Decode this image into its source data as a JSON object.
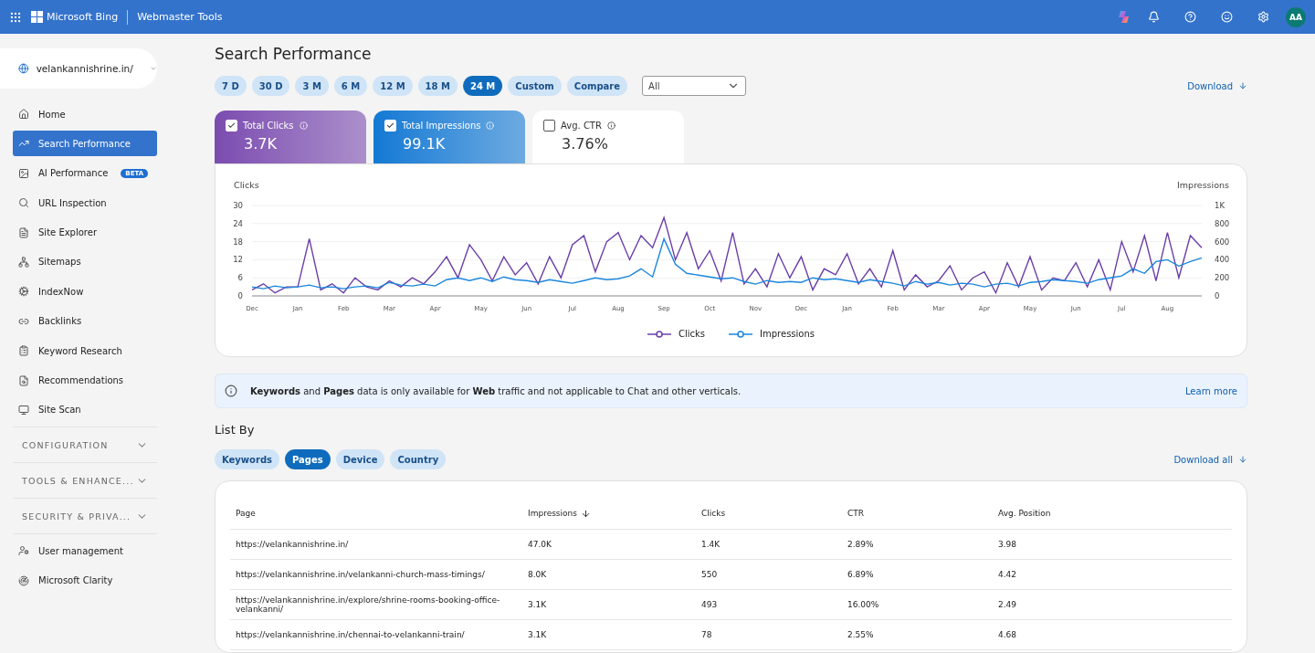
{
  "header": {
    "brand": "Microsoft Bing",
    "product": "Webmaster Tools",
    "avatar": "AA"
  },
  "sidebar": {
    "site": "velankannishrine.in/",
    "items": [
      {
        "label": "Home",
        "selected": false
      },
      {
        "label": "Search Performance",
        "selected": true
      },
      {
        "label": "AI Performance",
        "selected": false,
        "badge": "BETA"
      },
      {
        "label": "URL Inspection",
        "selected": false
      },
      {
        "label": "Site Explorer",
        "selected": false
      },
      {
        "label": "Sitemaps",
        "selected": false
      },
      {
        "label": "IndexNow",
        "selected": false
      },
      {
        "label": "Backlinks",
        "selected": false
      },
      {
        "label": "Keyword Research",
        "selected": false
      },
      {
        "label": "Recommendations",
        "selected": false
      },
      {
        "label": "Site Scan",
        "selected": false
      }
    ],
    "sections": [
      {
        "label": "CONFIGURATION",
        "expanded": false
      },
      {
        "label": "TOOLS & ENHANCE...",
        "expanded": false
      },
      {
        "label": "SECURITY & PRIVA...",
        "expanded": false
      }
    ],
    "footer_items": [
      {
        "label": "User management"
      },
      {
        "label": "Microsoft Clarity"
      }
    ]
  },
  "page": {
    "title": "Search Performance",
    "ranges": [
      {
        "label": "7 D",
        "selected": false
      },
      {
        "label": "30 D",
        "selected": false
      },
      {
        "label": "3 M",
        "selected": false
      },
      {
        "label": "6 M",
        "selected": false
      },
      {
        "label": "12 M",
        "selected": false
      },
      {
        "label": "18 M",
        "selected": false
      },
      {
        "label": "24 M",
        "selected": true
      },
      {
        "label": "Custom",
        "selected": false
      },
      {
        "label": "Compare",
        "selected": false
      }
    ],
    "filter": {
      "value": "All"
    },
    "download": "Download",
    "metrics": [
      {
        "label": "Total Clicks",
        "value": "3.7K",
        "checked": true,
        "color": "#7b4cb0"
      },
      {
        "label": "Total Impressions",
        "value": "99.1K",
        "checked": true,
        "color": "#1479d4"
      },
      {
        "label": "Avg. CTR",
        "value": "3.76%",
        "checked": false
      }
    ],
    "chart_data": {
      "type": "line",
      "grid": true,
      "legend": "bottom",
      "ylabel": "Clicks",
      "y2label": "Impressions",
      "categories": [
        "Dec",
        null,
        null,
        null,
        "Jan",
        null,
        null,
        null,
        "Feb",
        null,
        null,
        null,
        "Mar",
        null,
        null,
        null,
        "Apr",
        null,
        null,
        null,
        "May",
        null,
        null,
        null,
        "Jun",
        null,
        null,
        null,
        "Jul",
        null,
        null,
        null,
        "Aug",
        null,
        null,
        null,
        "Sep",
        null,
        null,
        null,
        "Oct",
        null,
        null,
        null,
        "Nov",
        null,
        null,
        null,
        "Dec",
        null,
        null,
        null,
        "Jan",
        null,
        null,
        null,
        "Feb",
        null,
        null,
        null,
        "Mar",
        null,
        null,
        null,
        "Apr",
        null,
        null,
        null,
        "May",
        null,
        null,
        null,
        "Jun",
        null,
        null,
        null,
        "Jul",
        null,
        null,
        null,
        "Aug",
        null,
        null,
        null
      ],
      "ylim": [
        0,
        30
      ],
      "yticks": [
        0,
        6,
        12,
        18,
        24,
        30
      ],
      "y2lim": [
        0,
        1000
      ],
      "y2ticks": [
        0,
        200,
        400,
        600,
        800,
        {
          "value": 1000,
          "label": "1K"
        }
      ],
      "series": [
        {
          "name": "Clicks",
          "color": "#6b3fa8",
          "values": [
            2,
            4,
            1,
            3,
            3,
            19,
            2,
            4,
            1,
            6,
            3,
            2,
            5,
            3,
            6,
            4,
            8,
            13,
            6,
            17,
            12,
            5,
            13,
            7,
            11,
            4,
            13,
            6,
            17,
            20,
            8,
            18,
            21,
            12,
            20,
            16,
            26,
            12,
            21,
            9,
            15,
            5,
            21,
            4,
            9,
            3,
            14,
            6,
            13,
            2,
            9,
            7,
            14,
            4,
            9,
            3,
            15,
            2,
            7,
            3,
            5,
            10,
            2,
            6,
            8,
            1,
            11,
            3,
            13,
            2,
            6,
            5,
            11,
            3,
            12,
            2,
            18,
            8,
            20,
            5,
            21,
            6,
            20,
            16
          ]
        },
        {
          "name": "Impressions",
          "color": "#1a86dc",
          "axis": "y2",
          "values": [
            100,
            80,
            110,
            90,
            100,
            120,
            90,
            100,
            80,
            100,
            110,
            90,
            150,
            120,
            110,
            130,
            110,
            180,
            200,
            170,
            200,
            160,
            210,
            180,
            170,
            150,
            180,
            160,
            140,
            170,
            200,
            180,
            190,
            220,
            300,
            210,
            630,
            350,
            250,
            230,
            210,
            190,
            200,
            160,
            130,
            170,
            150,
            160,
            150,
            200,
            180,
            190,
            170,
            150,
            180,
            160,
            140,
            110,
            160,
            130,
            150,
            120,
            140,
            130,
            100,
            130,
            140,
            110,
            150,
            160,
            180,
            170,
            160,
            140,
            180,
            200,
            220,
            300,
            250,
            380,
            400,
            330,
            380,
            420
          ]
        }
      ]
    },
    "notice": {
      "text": "**Keywords** and **Pages** data is only available for **Web** traffic and not applicable to Chat and other verticals.",
      "link": "Learn more"
    },
    "list_title": "List By",
    "list_tabs": [
      {
        "label": "Keywords",
        "selected": false
      },
      {
        "label": "Pages",
        "selected": true
      },
      {
        "label": "Device",
        "selected": false
      },
      {
        "label": "Country",
        "selected": false
      }
    ],
    "download_all": "Download all",
    "table": {
      "columns": [
        {
          "label": "Page",
          "sorted": false
        },
        {
          "label": "Impressions",
          "sorted": true
        },
        {
          "label": "Clicks",
          "sorted": false
        },
        {
          "label": "CTR",
          "sorted": false
        },
        {
          "label": "Avg. Position",
          "sorted": false
        }
      ],
      "rows": [
        [
          "https://velankannishrine.in/",
          "47.0K",
          "1.4K",
          "2.89%",
          "3.98"
        ],
        [
          "https://velankannishrine.in/velankanni-church-mass-timings/",
          "8.0K",
          "550",
          "6.89%",
          "4.42"
        ],
        [
          "https://velankannishrine.in/explore/shrine-rooms-booking-office-velankanni/",
          "3.1K",
          "493",
          "16.00%",
          "2.49"
        ],
        [
          "https://velankannishrine.in/chennai-to-velankanni-train/",
          "3.1K",
          "78",
          "2.55%",
          "4.68"
        ]
      ]
    }
  }
}
